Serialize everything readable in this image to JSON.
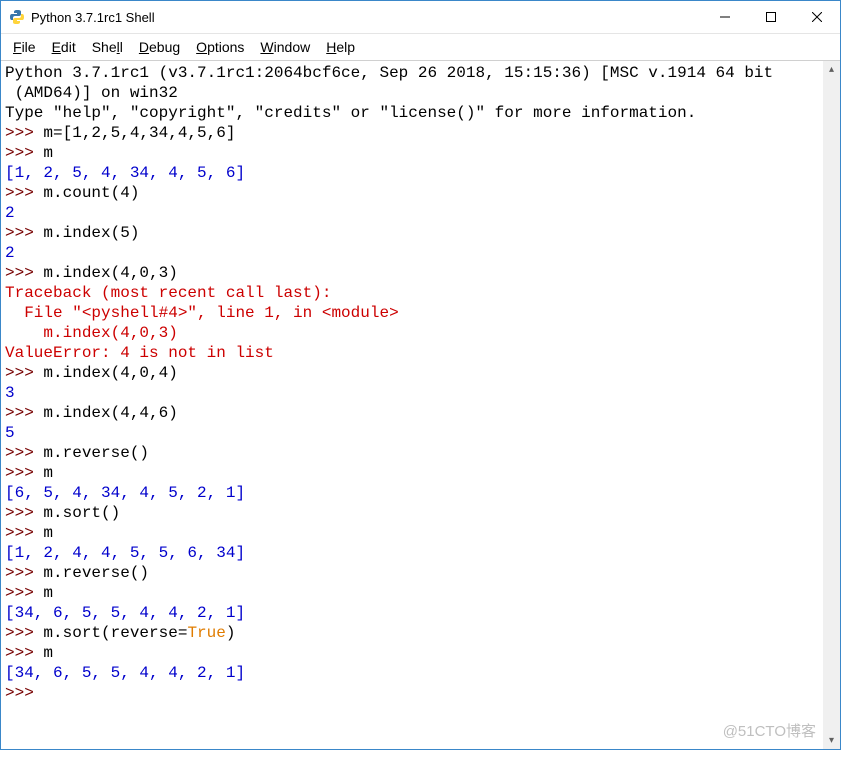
{
  "window": {
    "title": "Python 3.7.1rc1 Shell"
  },
  "menu": {
    "items": [
      {
        "u": "F",
        "rest": "ile"
      },
      {
        "u": "E",
        "rest": "dit"
      },
      {
        "u": "",
        "rest": "She",
        "u2": "l",
        "rest2": "l"
      },
      {
        "u": "D",
        "rest": "ebug"
      },
      {
        "u": "O",
        "rest": "ptions"
      },
      {
        "u": "W",
        "rest": "indow"
      },
      {
        "u": "H",
        "rest": "elp"
      }
    ]
  },
  "session": {
    "banner1": "Python 3.7.1rc1 (v3.7.1rc1:2064bcf6ce, Sep 26 2018, 15:15:36) [MSC v.1914 64 bit",
    "banner2": " (AMD64)] on win32",
    "banner3": "Type \"help\", \"copyright\", \"credits\" or \"license()\" for more information.",
    "prompt": ">>> ",
    "lines": {
      "in1": "m=[1,2,5,4,34,4,5,6]",
      "in2": "m",
      "out2": "[1, 2, 5, 4, 34, 4, 5, 6]",
      "in3": "m.count(4)",
      "out3": "2",
      "in4": "m.index(5)",
      "out4": "2",
      "in5": "m.index(4,0,3)",
      "err1": "Traceback (most recent call last):",
      "err2": "  File \"<pyshell#4>\", line 1, in <module>",
      "err3": "    m.index(4,0,3)",
      "err4": "ValueError: 4 is not in list",
      "in6": "m.index(4,0,4)",
      "out6": "3",
      "in7": "m.index(4,4,6)",
      "out7": "5",
      "in8": "m.reverse()",
      "in9": "m",
      "out9": "[6, 5, 4, 34, 4, 5, 2, 1]",
      "in10": "m.sort()",
      "in11": "m",
      "out11": "[1, 2, 4, 4, 5, 5, 6, 34]",
      "in12": "m.reverse()",
      "in13": "m",
      "out13": "[34, 6, 5, 5, 4, 4, 2, 1]",
      "in14a": "m.sort(reverse=",
      "in14kw": "True",
      "in14b": ")",
      "in15": "m",
      "out15": "[34, 6, 5, 5, 4, 4, 2, 1]",
      "inEmpty": ""
    }
  },
  "watermark": "@51CTO博客"
}
